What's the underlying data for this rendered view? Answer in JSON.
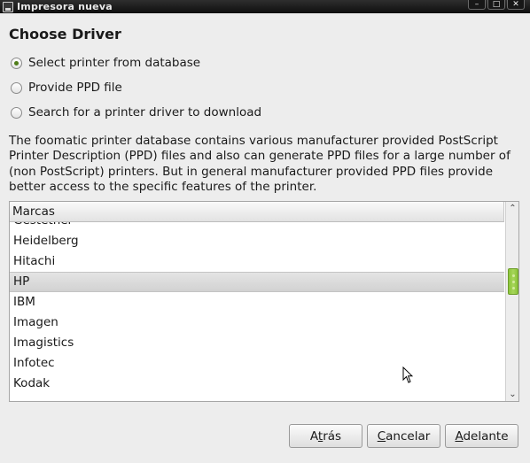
{
  "window": {
    "title": "Impresora nueva",
    "controls": [
      "minimize",
      "maximize",
      "close"
    ]
  },
  "heading": "Choose Driver",
  "options": [
    {
      "label": "Select printer from database",
      "checked": true
    },
    {
      "label": "Provide PPD file",
      "checked": false
    },
    {
      "label": "Search for a printer driver to download",
      "checked": false
    }
  ],
  "description": "The foomatic printer database contains various manufacturer provided PostScript Printer Description (PPD) files and also can generate PPD files for a large number of (non PostScript) printers. But in general manufacturer provided PPD files provide better access to the specific features of the printer.",
  "list": {
    "header": "Marcas",
    "items": [
      "Gestetner",
      "Heidelberg",
      "Hitachi",
      "HP",
      "IBM",
      "Imagen",
      "Imagistics",
      "Infotec",
      "Kodak"
    ],
    "selected": "HP"
  },
  "buttons": {
    "back": {
      "label": "Atrás",
      "mnemonic": "t"
    },
    "cancel": {
      "label": "Cancelar",
      "mnemonic": "C"
    },
    "forward": {
      "label": "Adelante",
      "mnemonic": "A"
    }
  },
  "colors": {
    "titlebar": "#1a1a1a",
    "accent": "#8cc43b",
    "selection": "#d8d8d8"
  }
}
